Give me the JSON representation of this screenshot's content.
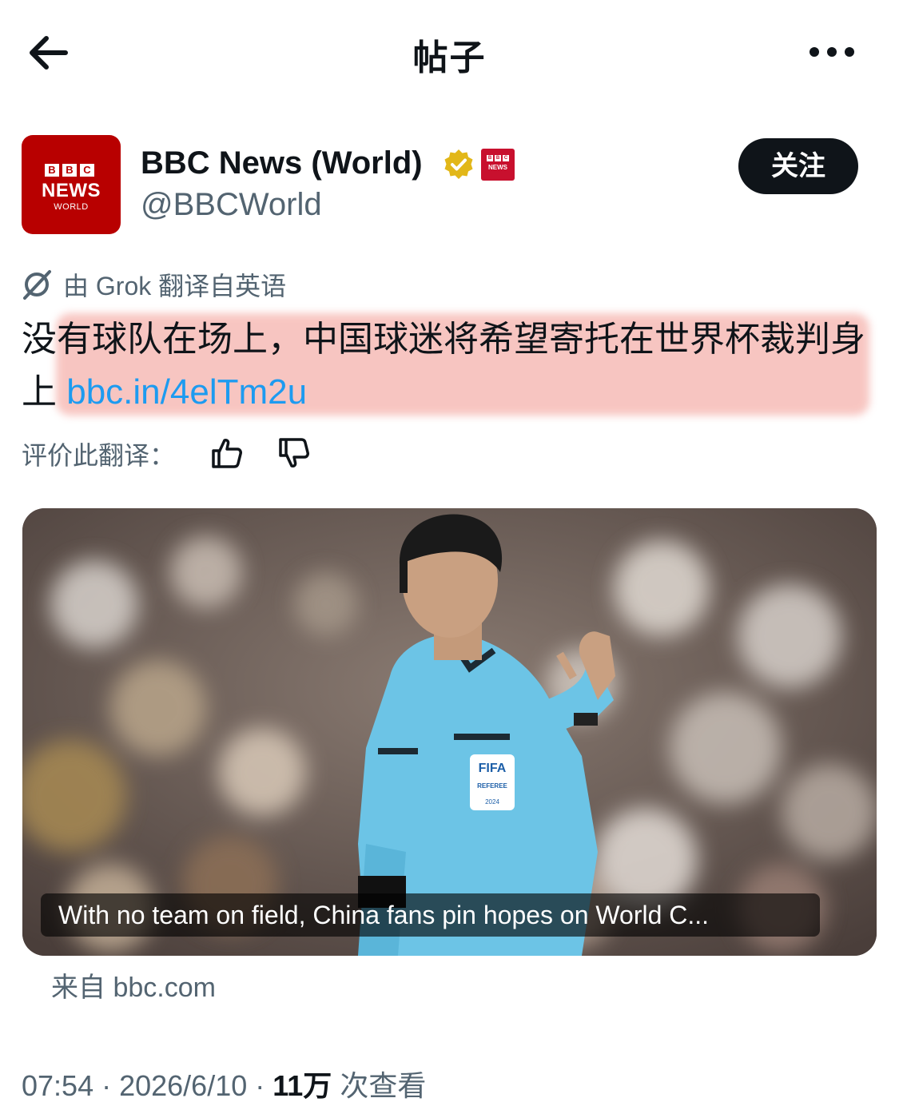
{
  "header": {
    "title": "帖子",
    "back_icon": "arrow-left-icon",
    "more_icon": "more-horizontal-icon"
  },
  "account": {
    "avatar": {
      "line1": [
        "B",
        "B",
        "C"
      ],
      "line2": "NEWS",
      "line3": "WORLD",
      "bg_color": "#b80000"
    },
    "display_name": "BBC News (World)",
    "handle": "@BBCWorld",
    "verified_badge": "gold-verified-badge-icon",
    "affiliate_badge": {
      "letters": [
        "B",
        "B",
        "C"
      ],
      "text": "NEWS",
      "color": "#c8102e"
    },
    "follow_label": "关注"
  },
  "translation": {
    "notice": "由 Grok 翻译自英语",
    "rate_label": "评价此翻译："
  },
  "post": {
    "text": "没有球队在场上，中国球迷将希望寄托在世界杯裁判身上",
    "link": "bbc.in/4elTm2u",
    "highlight_color": "#f5b0aa"
  },
  "card": {
    "headline": "With no team on field, China fans pin hopes on World C...",
    "source": "来自 bbc.com",
    "jersey_logo": "FIFA",
    "jersey_badge": "REFEREE",
    "jersey_year": "2024"
  },
  "meta": {
    "time": "07:54",
    "sep1": " · ",
    "date": "2026/6/10",
    "sep2": " · ",
    "views": "11万",
    "views_label": " 次查看"
  },
  "colors": {
    "text": "#0f1419",
    "secondary": "#536471",
    "link": "#1d9bf0",
    "verified_gold": "#e2b719"
  }
}
